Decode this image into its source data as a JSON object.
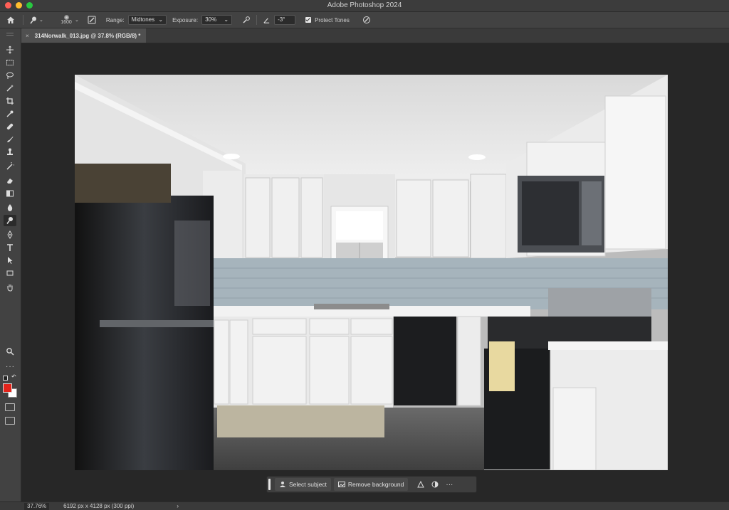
{
  "app": {
    "title": "Adobe Photoshop 2024"
  },
  "options_bar": {
    "brush_size": "1600",
    "range_label": "Range:",
    "range_value": "Midtones",
    "exposure_label": "Exposure:",
    "exposure_value": "30%",
    "angle_value": "-3°",
    "protect_tones_label": "Protect Tones"
  },
  "document": {
    "tab_title": "314Norwalk_013.jpg @ 37.8% (RGB/8) *",
    "close_glyph": "×"
  },
  "tools": [
    {
      "name": "move-tool",
      "icon": "move-icon"
    },
    {
      "name": "marquee-tool",
      "icon": "rect-marquee-icon"
    },
    {
      "name": "lasso-tool",
      "icon": "lasso-icon"
    },
    {
      "name": "magic-wand-tool",
      "icon": "magic-wand-icon"
    },
    {
      "name": "crop-tool",
      "icon": "crop-icon"
    },
    {
      "name": "eyedropper-tool",
      "icon": "eyedropper-icon"
    },
    {
      "name": "healing-brush-tool",
      "icon": "bandage-icon"
    },
    {
      "name": "brush-tool",
      "icon": "brush-icon"
    },
    {
      "name": "clone-stamp-tool",
      "icon": "stamp-icon"
    },
    {
      "name": "history-brush-tool",
      "icon": "history-brush-icon"
    },
    {
      "name": "eraser-tool",
      "icon": "eraser-icon"
    },
    {
      "name": "gradient-tool",
      "icon": "gradient-icon"
    },
    {
      "name": "blur-tool",
      "icon": "drop-icon"
    },
    {
      "name": "dodge-tool",
      "icon": "dodge-icon"
    },
    {
      "name": "pen-tool",
      "icon": "pen-icon"
    },
    {
      "name": "type-tool",
      "icon": "type-icon"
    },
    {
      "name": "path-selection-tool",
      "icon": "arrow-icon"
    },
    {
      "name": "rectangle-tool",
      "icon": "rectangle-icon"
    },
    {
      "name": "hand-tool",
      "icon": "hand-icon"
    },
    {
      "name": "zoom-tool",
      "icon": "zoom-icon"
    }
  ],
  "colors": {
    "foreground": "#e2231a",
    "background": "#ffffff",
    "light_red": "#ff5f57",
    "light_yellow": "#febc2e",
    "light_green": "#28c840"
  },
  "contextual_bar": {
    "select_subject": "Select subject",
    "remove_background": "Remove background",
    "more": "···"
  },
  "status": {
    "zoom": "37.76%",
    "doc_info": "6192 px x 4128 px (300 ppi)",
    "arrow": "›"
  }
}
